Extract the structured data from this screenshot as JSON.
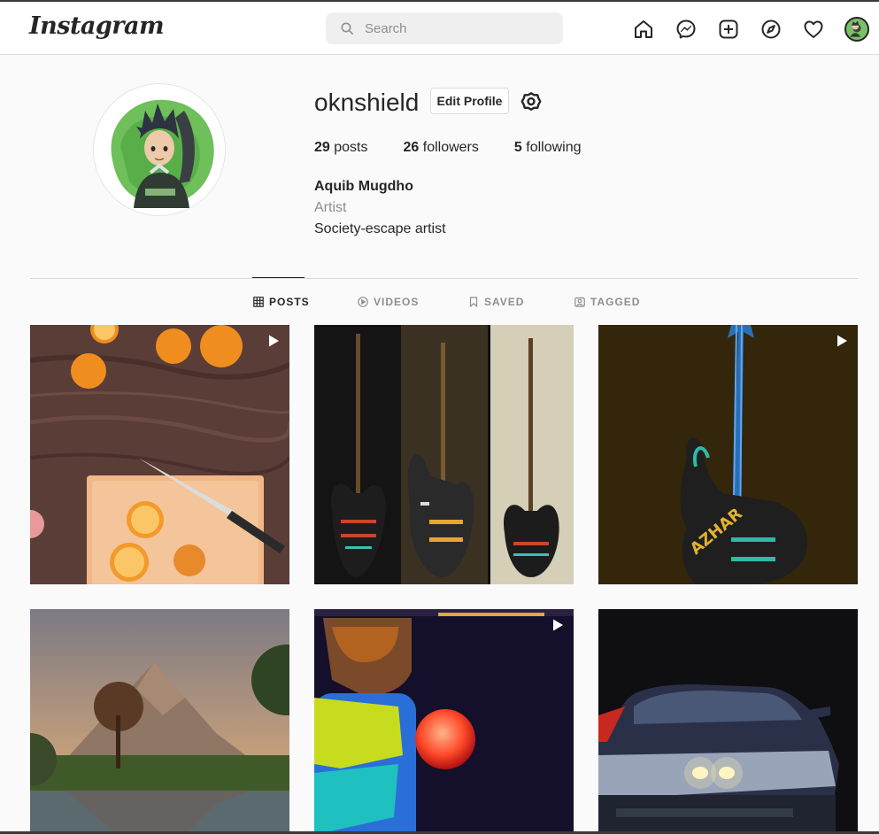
{
  "header": {
    "logo": "Instagram",
    "search_placeholder": "Search"
  },
  "profile": {
    "username": "oknshield",
    "edit_label": "Edit Profile",
    "stats": [
      {
        "count": "29",
        "label": "posts"
      },
      {
        "count": "26",
        "label": "followers"
      },
      {
        "count": "5",
        "label": "following"
      }
    ],
    "full_name": "Aquib Mugdho",
    "category": "Artist",
    "bio": "Society-escape artist"
  },
  "tabs": [
    {
      "label": "POSTS",
      "icon": "grid-icon",
      "active": true
    },
    {
      "label": "VIDEOS",
      "icon": "video-icon",
      "active": false
    },
    {
      "label": "SAVED",
      "icon": "bookmark-icon",
      "active": false
    },
    {
      "label": "TAGGED",
      "icon": "tag-user-icon",
      "active": false
    }
  ],
  "posts": [
    {
      "kind": "video",
      "subject": "oranges-on-wood"
    },
    {
      "kind": "image",
      "subject": "three-guitars"
    },
    {
      "kind": "video",
      "subject": "neon-guitar"
    },
    {
      "kind": "image",
      "subject": "mountain-lake"
    },
    {
      "kind": "video",
      "subject": "robot-orb"
    },
    {
      "kind": "image",
      "subject": "car-headlights"
    }
  ],
  "colors": {
    "text": "#262626",
    "muted": "#8e8e8e",
    "border": "#dbdbdb",
    "background": "#fafafa"
  }
}
